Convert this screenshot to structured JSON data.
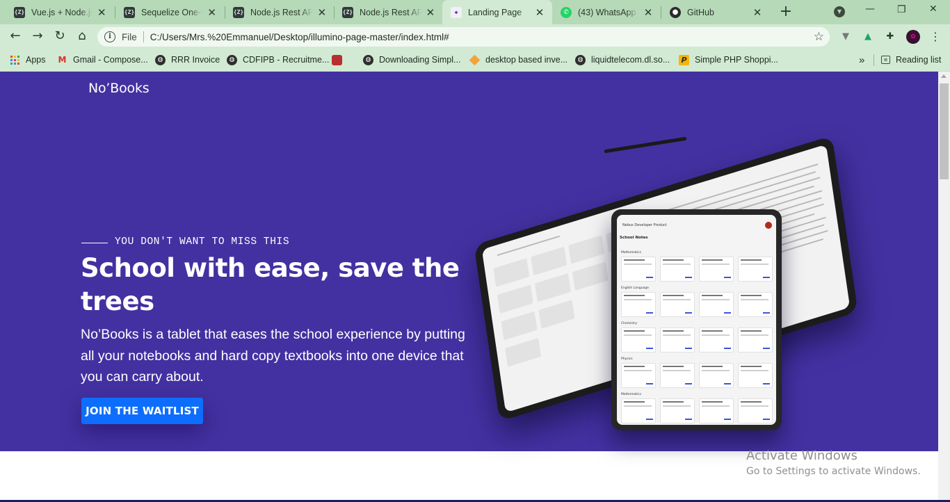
{
  "browser": {
    "tabs": [
      {
        "title": "Vue.js + Node.js",
        "favicon": "sequelize-icon"
      },
      {
        "title": "Sequelize One-to",
        "favicon": "sequelize-icon"
      },
      {
        "title": "Node.js Rest APIs",
        "favicon": "sequelize-icon"
      },
      {
        "title": "Node.js Rest APIs",
        "favicon": "sequelize-icon"
      },
      {
        "title": "Landing Page",
        "favicon": "landing-page-icon",
        "active": true
      },
      {
        "title": "(43) WhatsApp",
        "favicon": "whatsapp-icon"
      },
      {
        "title": "GitHub",
        "favicon": "github-icon"
      }
    ],
    "favicon_text": {
      "sequelize": "{Z}",
      "whatsapp_badge": "43"
    },
    "address": {
      "scheme_label": "File",
      "url": "C:/Users/Mrs.%20Emmanuel/Desktop/illumino-page-master/index.html#"
    },
    "bookmarks": [
      {
        "label": "Apps",
        "icon": "apps-grid-icon"
      },
      {
        "label": "Gmail - Compose...",
        "icon": "gmail-icon"
      },
      {
        "label": "RRR Invoice",
        "icon": "globe-icon"
      },
      {
        "label": "CDFIPB - Recruitme...",
        "icon": "globe-icon"
      },
      {
        "label": "",
        "icon": "image-icon"
      },
      {
        "label": "Downloading Simpl...",
        "icon": "globe-icon"
      },
      {
        "label": "desktop based inve...",
        "icon": "diamond-icon"
      },
      {
        "label": "liquidtelecom.dl.so...",
        "icon": "globe-icon"
      },
      {
        "label": "Simple PHP Shoppi...",
        "icon": "php-icon"
      }
    ],
    "overflow_label": "»",
    "reading_list_label": "Reading list",
    "accent_color": "#b6d9b8"
  },
  "page": {
    "brand": "No’Books",
    "kicker": "YOU DON'T WANT TO MISS THIS",
    "headline": "School with ease, save the trees",
    "lead": "No’Books is a tablet that eases the school experience by putting all your notebooks and hard copy textbooks into one device that you can carry about.",
    "cta_label": "JOIN THE WAITLIST",
    "hero_color": "#4331a1",
    "cta_color": "#0d6efd"
  },
  "tablet_screen": {
    "app_title": "Nebus Developer Product",
    "section_title": "School Notes",
    "sections": [
      "Mathematics",
      "English Language",
      "Chemistry",
      "Physics",
      "Mathematics"
    ]
  },
  "windows_watermark": {
    "line1": "Activate Windows",
    "line2": "Go to Settings to activate Windows."
  }
}
